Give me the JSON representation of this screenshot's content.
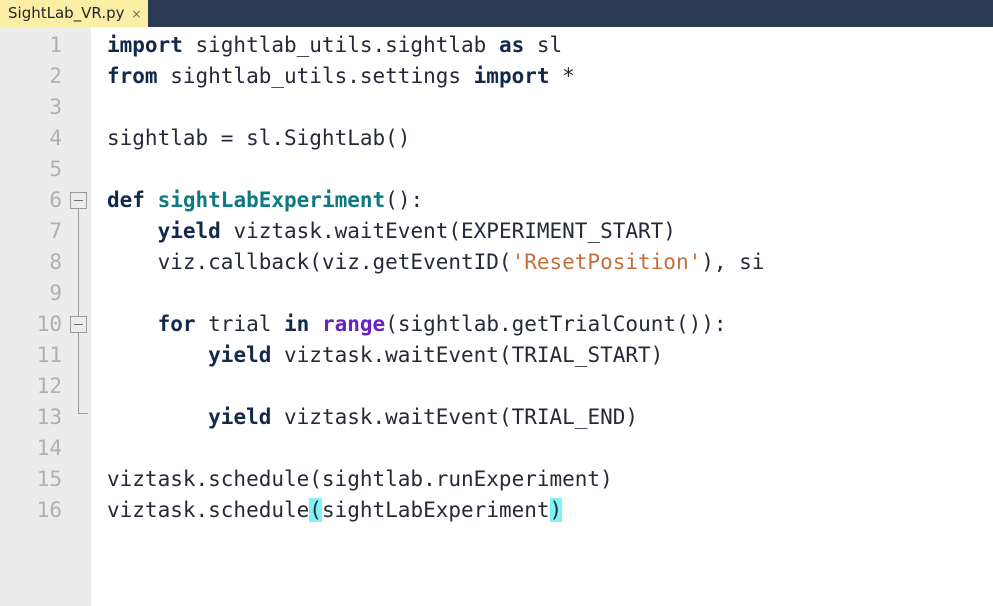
{
  "window": {
    "tabbar_bg": "#2b3952",
    "editor_bg": "#ffffff",
    "gutter_bg": "#ececec"
  },
  "tabbar": {
    "tabs": [
      {
        "label": "SightLab_VR.py",
        "close_label": "×",
        "active": true
      }
    ]
  },
  "editor": {
    "line_numbers": [
      "1",
      "2",
      "3",
      "4",
      "5",
      "6",
      "7",
      "8",
      "9",
      "10",
      "11",
      "12",
      "13",
      "14",
      "15",
      "16"
    ],
    "fold_markers": [
      {
        "line": 6,
        "state": "expanded"
      },
      {
        "line": 10,
        "state": "expanded"
      }
    ],
    "colors": {
      "keyword": "#13294b",
      "function": "#0d7a82",
      "builtin": "#6b21c8",
      "string": "#c4703a",
      "plain": "#262a38",
      "bracket_match_bg": "#7ff4f4",
      "linenumber": "#b0b0b0"
    },
    "lines": [
      {
        "n": "1",
        "tokens": [
          {
            "t": "import",
            "c": "kw"
          },
          {
            "t": " sightlab_utils.sightlab ",
            "c": "plain"
          },
          {
            "t": "as",
            "c": "kw"
          },
          {
            "t": " sl",
            "c": "plain"
          }
        ]
      },
      {
        "n": "2",
        "tokens": [
          {
            "t": "from",
            "c": "kw"
          },
          {
            "t": " sightlab_utils.settings ",
            "c": "plain"
          },
          {
            "t": "import",
            "c": "kw"
          },
          {
            "t": " *",
            "c": "plain"
          }
        ]
      },
      {
        "n": "3",
        "tokens": []
      },
      {
        "n": "4",
        "tokens": [
          {
            "t": "sightlab = sl.SightLab()",
            "c": "plain"
          }
        ]
      },
      {
        "n": "5",
        "tokens": []
      },
      {
        "n": "6",
        "tokens": [
          {
            "t": "def",
            "c": "kw"
          },
          {
            "t": " ",
            "c": "plain"
          },
          {
            "t": "sightLabExperiment",
            "c": "fn"
          },
          {
            "t": "():",
            "c": "plain"
          }
        ]
      },
      {
        "n": "7",
        "tokens": [
          {
            "t": "    ",
            "c": "plain"
          },
          {
            "t": "yield",
            "c": "kw"
          },
          {
            "t": " viztask.waitEvent(EXPERIMENT_START)",
            "c": "plain"
          }
        ]
      },
      {
        "n": "8",
        "tokens": [
          {
            "t": "    viz.callback(viz.getEventID(",
            "c": "plain"
          },
          {
            "t": "'ResetPosition'",
            "c": "str"
          },
          {
            "t": "), si",
            "c": "plain"
          }
        ]
      },
      {
        "n": "9",
        "tokens": []
      },
      {
        "n": "10",
        "tokens": [
          {
            "t": "    ",
            "c": "plain"
          },
          {
            "t": "for",
            "c": "kw"
          },
          {
            "t": " trial ",
            "c": "plain"
          },
          {
            "t": "in",
            "c": "kw"
          },
          {
            "t": " ",
            "c": "plain"
          },
          {
            "t": "range",
            "c": "bi"
          },
          {
            "t": "(sightlab.getTrialCount()):",
            "c": "plain"
          }
        ]
      },
      {
        "n": "11",
        "tokens": [
          {
            "t": "        ",
            "c": "plain"
          },
          {
            "t": "yield",
            "c": "kw"
          },
          {
            "t": " viztask.waitEvent(TRIAL_START)",
            "c": "plain"
          }
        ]
      },
      {
        "n": "12",
        "tokens": []
      },
      {
        "n": "13",
        "tokens": [
          {
            "t": "        ",
            "c": "plain"
          },
          {
            "t": "yield",
            "c": "kw"
          },
          {
            "t": " viztask.waitEvent(TRIAL_END)",
            "c": "plain"
          }
        ]
      },
      {
        "n": "14",
        "tokens": []
      },
      {
        "n": "15",
        "tokens": [
          {
            "t": "viztask.schedule(sightlab.runExperiment)",
            "c": "plain"
          }
        ]
      },
      {
        "n": "16",
        "tokens": [
          {
            "t": "viztask.schedule",
            "c": "plain"
          },
          {
            "t": "(",
            "c": "plain brk"
          },
          {
            "t": "sightLabExperiment",
            "c": "plain"
          },
          {
            "t": ")",
            "c": "plain brk"
          }
        ]
      }
    ]
  }
}
